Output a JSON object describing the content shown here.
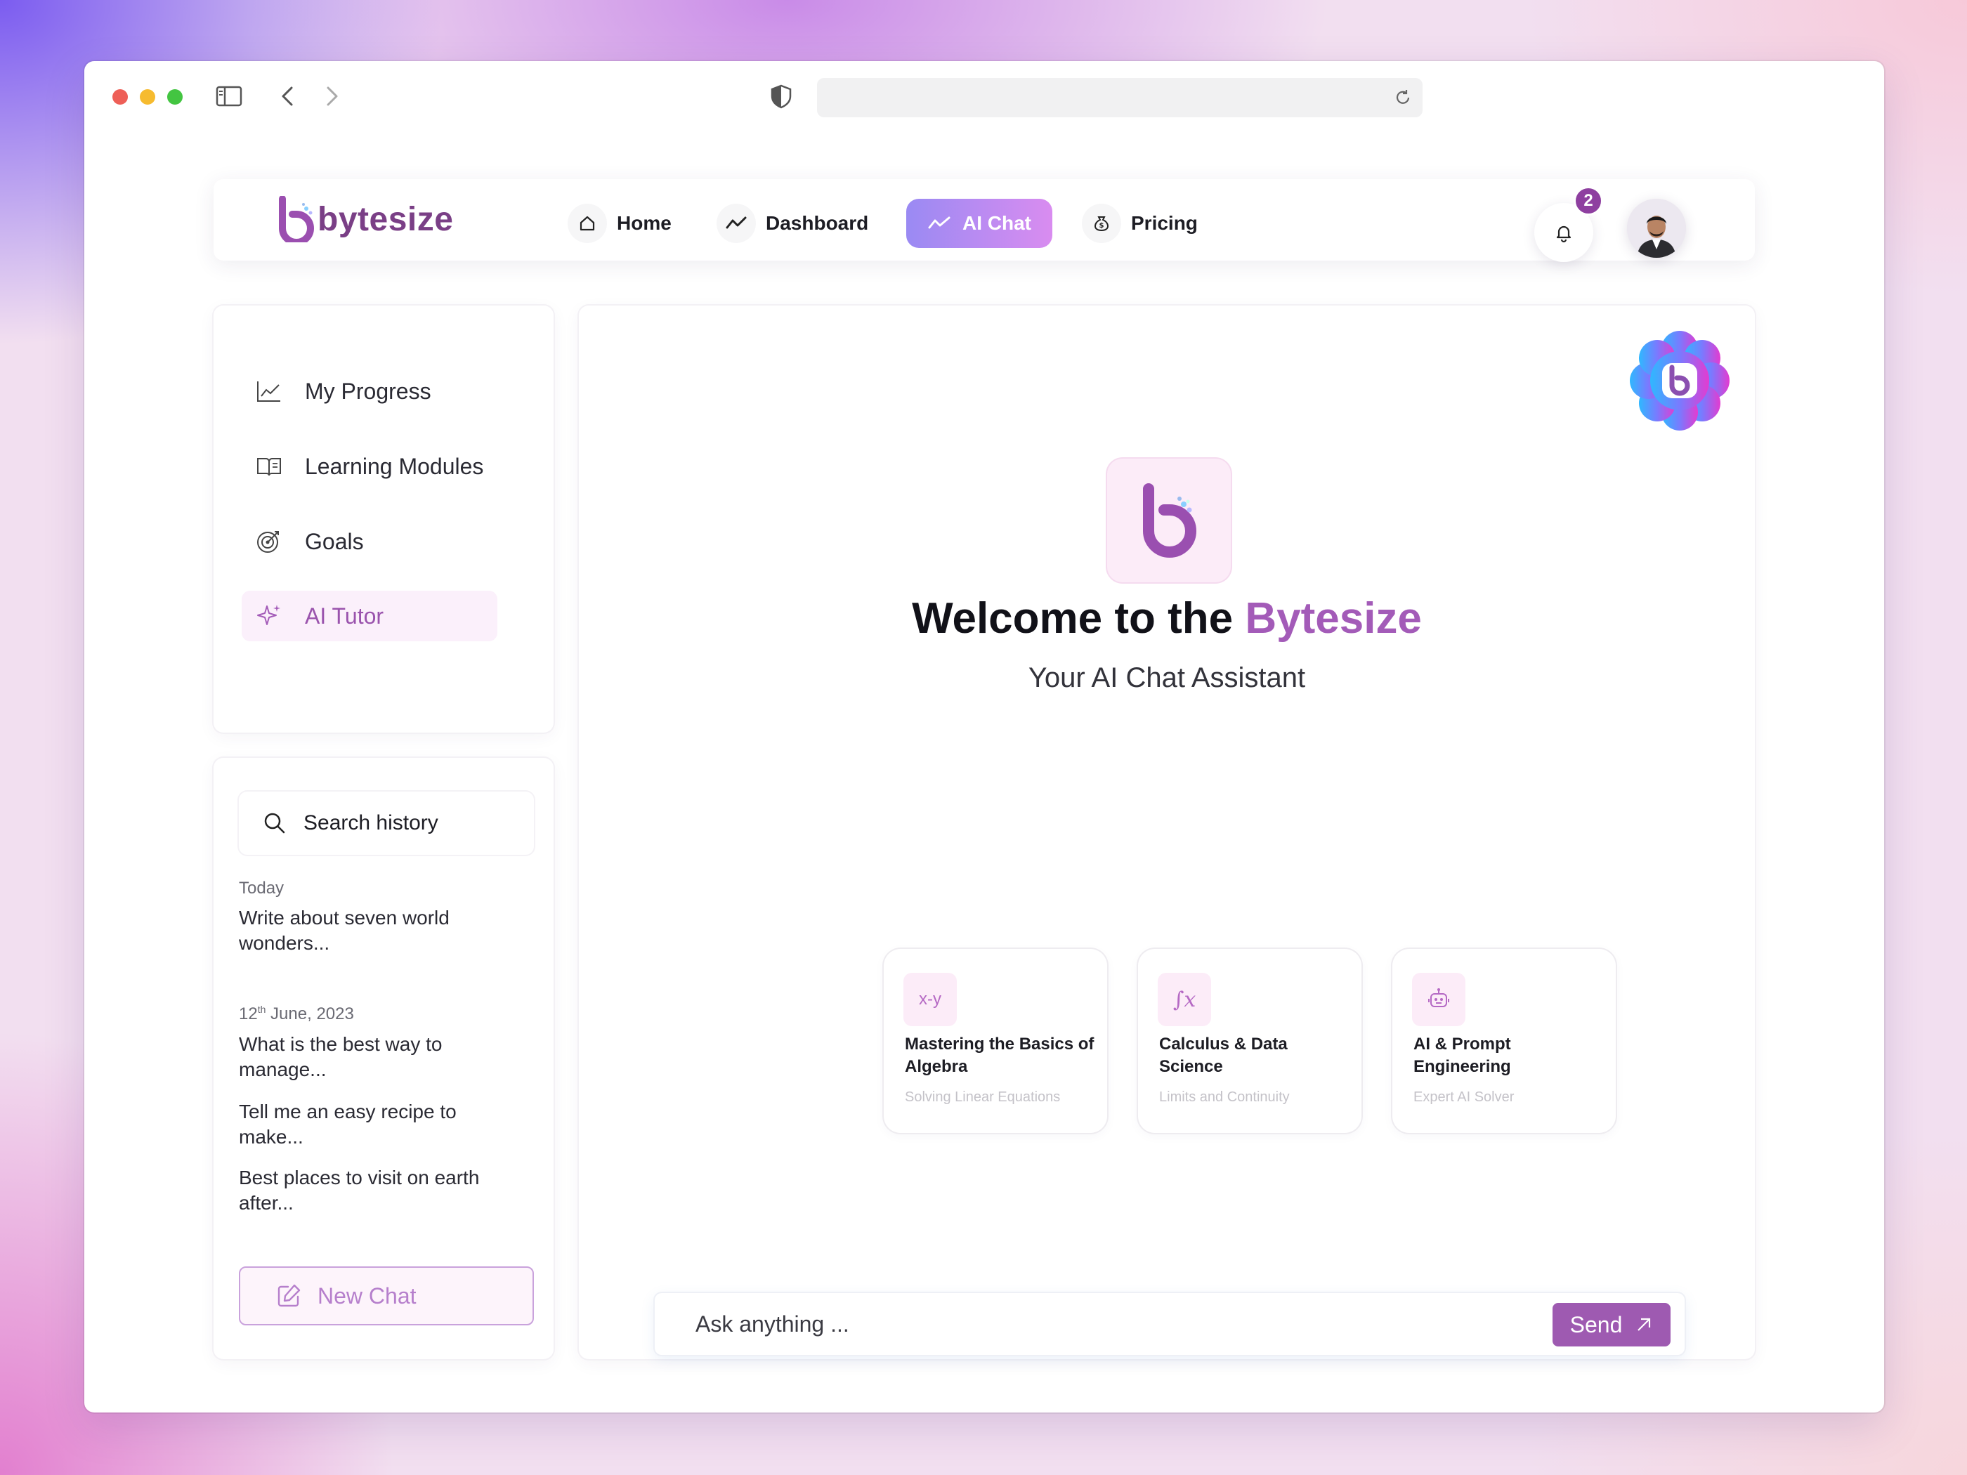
{
  "brand": {
    "name": "bytesize",
    "color": "#7a3f86",
    "accent": "#a35bb8"
  },
  "nav": {
    "items": [
      {
        "label": "Home",
        "icon": "home-icon"
      },
      {
        "label": "Dashboard",
        "icon": "trend-icon"
      },
      {
        "label": "AI Chat",
        "icon": "trend-icon",
        "active": true
      },
      {
        "label": "Pricing",
        "icon": "money-bag-icon"
      }
    ],
    "notification_count": "2"
  },
  "sidebar": {
    "items": [
      {
        "label": "My Progress",
        "icon": "chart-line-icon"
      },
      {
        "label": "Learning Modules",
        "icon": "book-icon"
      },
      {
        "label": "Goals",
        "icon": "target-icon"
      },
      {
        "label": "AI Tutor",
        "icon": "sparkle-icon",
        "active": true
      }
    ]
  },
  "history": {
    "search_placeholder": "Search history",
    "groups": [
      {
        "date": "Today",
        "items": [
          "Write about seven world wonders..."
        ]
      },
      {
        "date_prefix": "12",
        "date_sup": "th",
        "date_suffix": " June, 2023",
        "items": [
          "What is the best way to manage...",
          "Tell me an easy recipe to make...",
          "Best places to visit on earth after..."
        ]
      }
    ],
    "new_chat_label": "New Chat"
  },
  "main": {
    "welcome_prefix": "Welcome to the ",
    "welcome_accent": "Bytesize",
    "subtitle": "Your AI Chat Assistant",
    "cards": [
      {
        "icon_text": "x-y",
        "title": "Mastering the Basics of Algebra",
        "subtitle": "Solving Linear Equations"
      },
      {
        "icon_text": "∫x",
        "title": "Calculus & Data Science",
        "subtitle": "Limits and Continuity"
      },
      {
        "icon_text": "",
        "icon": "robot-icon",
        "title": "AI & Prompt Engineering",
        "subtitle": "Expert AI Solver"
      }
    ],
    "input_placeholder": "Ask anything ...",
    "send_label": "Send"
  }
}
